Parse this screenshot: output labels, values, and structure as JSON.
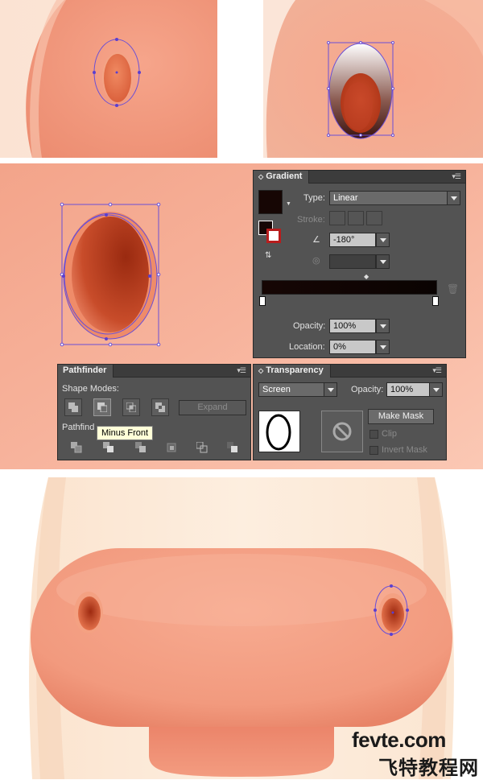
{
  "gradient_panel": {
    "tab_label": "Gradient",
    "type_label": "Type:",
    "type_value": "Linear",
    "stroke_label": "Stroke:",
    "angle_value": "-180°",
    "opacity_label": "Opacity:",
    "opacity_value": "100%",
    "location_label": "Location:",
    "location_value": "0%"
  },
  "pathfinder_panel": {
    "tab_label": "Pathfinder",
    "shape_modes_label": "Shape Modes:",
    "pathfinders_label": "Pathfind",
    "expand_label": "Expand",
    "tooltip": "Minus Front",
    "shape_mode_icons": [
      "unite-icon",
      "minus-front-icon",
      "intersect-icon",
      "exclude-icon"
    ],
    "pathfinder_icons": [
      "divide-icon",
      "trim-icon",
      "merge-icon",
      "crop-icon",
      "outline-icon",
      "minus-back-icon"
    ]
  },
  "transparency_panel": {
    "tab_label": "Transparency",
    "blend_mode_value": "Screen",
    "opacity_label": "Opacity:",
    "opacity_value": "100%",
    "make_mask_label": "Make Mask",
    "clip_label": "Clip",
    "invert_mask_label": "Invert Mask"
  },
  "watermark": {
    "site": "fevte.com",
    "chinese": "飞特教程网"
  },
  "colors": {
    "skin": "#f4a58a",
    "nostril": "#c9482a",
    "selection": "#6a4fd6",
    "panel_bg": "#535353"
  }
}
